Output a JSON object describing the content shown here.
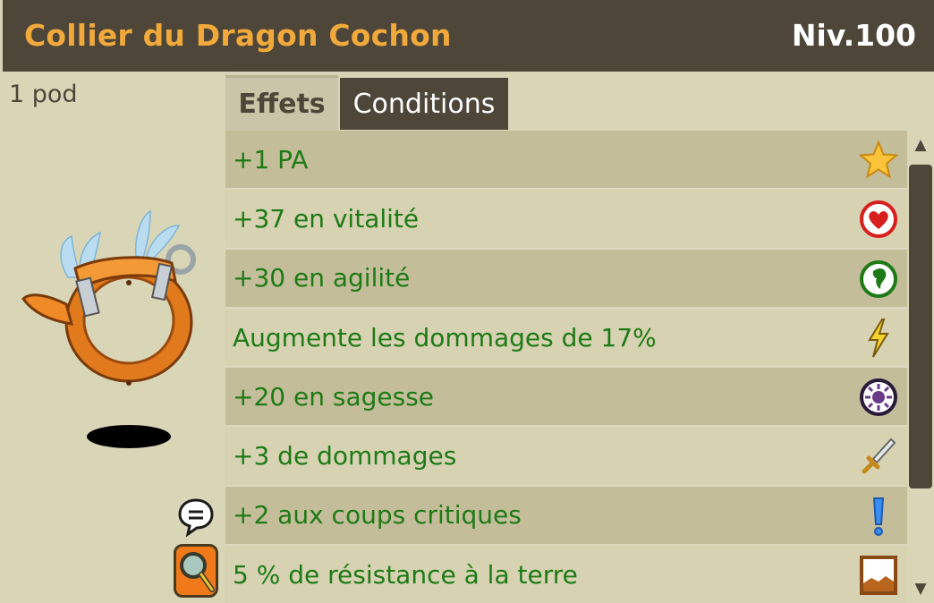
{
  "header": {
    "item_name": "Collier du Dragon Cochon",
    "level": "Niv.100"
  },
  "left_panel": {
    "weight": "1 pod"
  },
  "tabs": [
    {
      "label": "Effets",
      "active": true
    },
    {
      "label": "Conditions",
      "active": false
    }
  ],
  "effects": [
    {
      "text": "+1 PA",
      "icon": "star-icon"
    },
    {
      "text": "+37 en vitalité",
      "icon": "heart-icon"
    },
    {
      "text": "+30 en agilité",
      "icon": "agility-icon"
    },
    {
      "text": "Augmente les dommages de 17%",
      "icon": "lightning-icon"
    },
    {
      "text": "+20 en sagesse",
      "icon": "wisdom-icon"
    },
    {
      "text": "+3 de dommages",
      "icon": "sword-icon"
    },
    {
      "text": "+2 aux coups critiques",
      "icon": "exclamation-icon"
    },
    {
      "text": "5 % de résistance à la terre",
      "icon": "earth-icon"
    }
  ],
  "scrollbar": {
    "up": "▲",
    "down": "▼"
  },
  "colors": {
    "title_bar": "#4d4639",
    "title_text": "#f0a93a",
    "effect_text": "#1e7a16"
  }
}
